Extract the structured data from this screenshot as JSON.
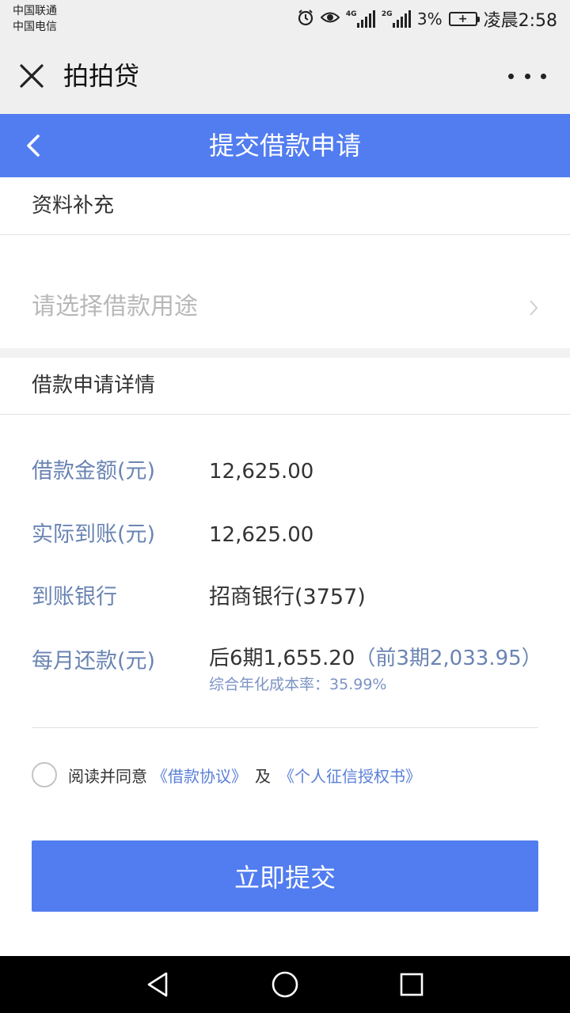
{
  "status_bar": {
    "carrier_1": "中国联通",
    "carrier_2": "中国电信",
    "network_1": "4G",
    "network_2": "2G",
    "battery": "3%",
    "time": "凌晨2:58",
    "icons": [
      "alarm-icon",
      "eye-icon",
      "signal-icon",
      "battery-icon"
    ]
  },
  "title_bar": {
    "title": "拍拍贷",
    "close_icon": "close-icon",
    "more_icon": "more-icon"
  },
  "header": {
    "title": "提交借款申请",
    "back_icon": "chevron-left-icon"
  },
  "supplement": {
    "section_title": "资料补充",
    "purpose_placeholder": "请选择借款用途"
  },
  "details": {
    "section_title": "借款申请详情",
    "rows": [
      {
        "label": "借款金额(元)",
        "value": "12,625.00"
      },
      {
        "label": "实际到账(元)",
        "value": "12,625.00"
      },
      {
        "label": "到账银行",
        "value": "招商银行(3757)"
      },
      {
        "label": "每月还款(元)",
        "value": "后6期1,655.20",
        "extra": "（前3期2,033.95）"
      }
    ],
    "rate_label": "综合年化成本率：",
    "rate_value": "35.99%"
  },
  "agreement": {
    "prefix": "阅读并同意",
    "link_1": "《借款协议》",
    "and": "及",
    "link_2": "《个人征信授权书》",
    "checked": false
  },
  "submit_label": "立即提交",
  "colors": {
    "brand_blue": "#527df0",
    "label_blue": "#6a84b3",
    "link_blue": "#5a7fd8"
  }
}
